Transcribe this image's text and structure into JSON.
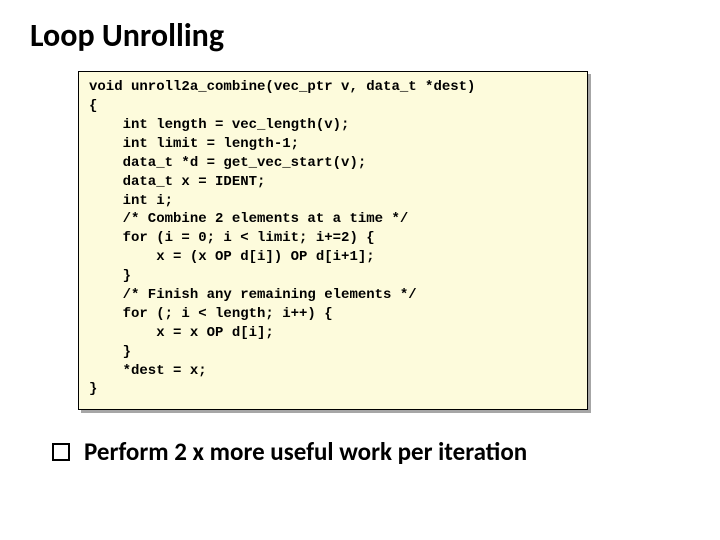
{
  "slide": {
    "title": "Loop Unrolling",
    "code": "void unroll2a_combine(vec_ptr v, data_t *dest)\n{\n    int length = vec_length(v);\n    int limit = length-1;\n    data_t *d = get_vec_start(v);\n    data_t x = IDENT;\n    int i;\n    /* Combine 2 elements at a time */\n    for (i = 0; i < limit; i+=2) {\n        x = (x OP d[i]) OP d[i+1];\n    }\n    /* Finish any remaining elements */\n    for (; i < length; i++) {\n        x = x OP d[i];\n    }\n    *dest = x;\n}",
    "bullet": "Perform 2 x more useful work per iteration"
  }
}
